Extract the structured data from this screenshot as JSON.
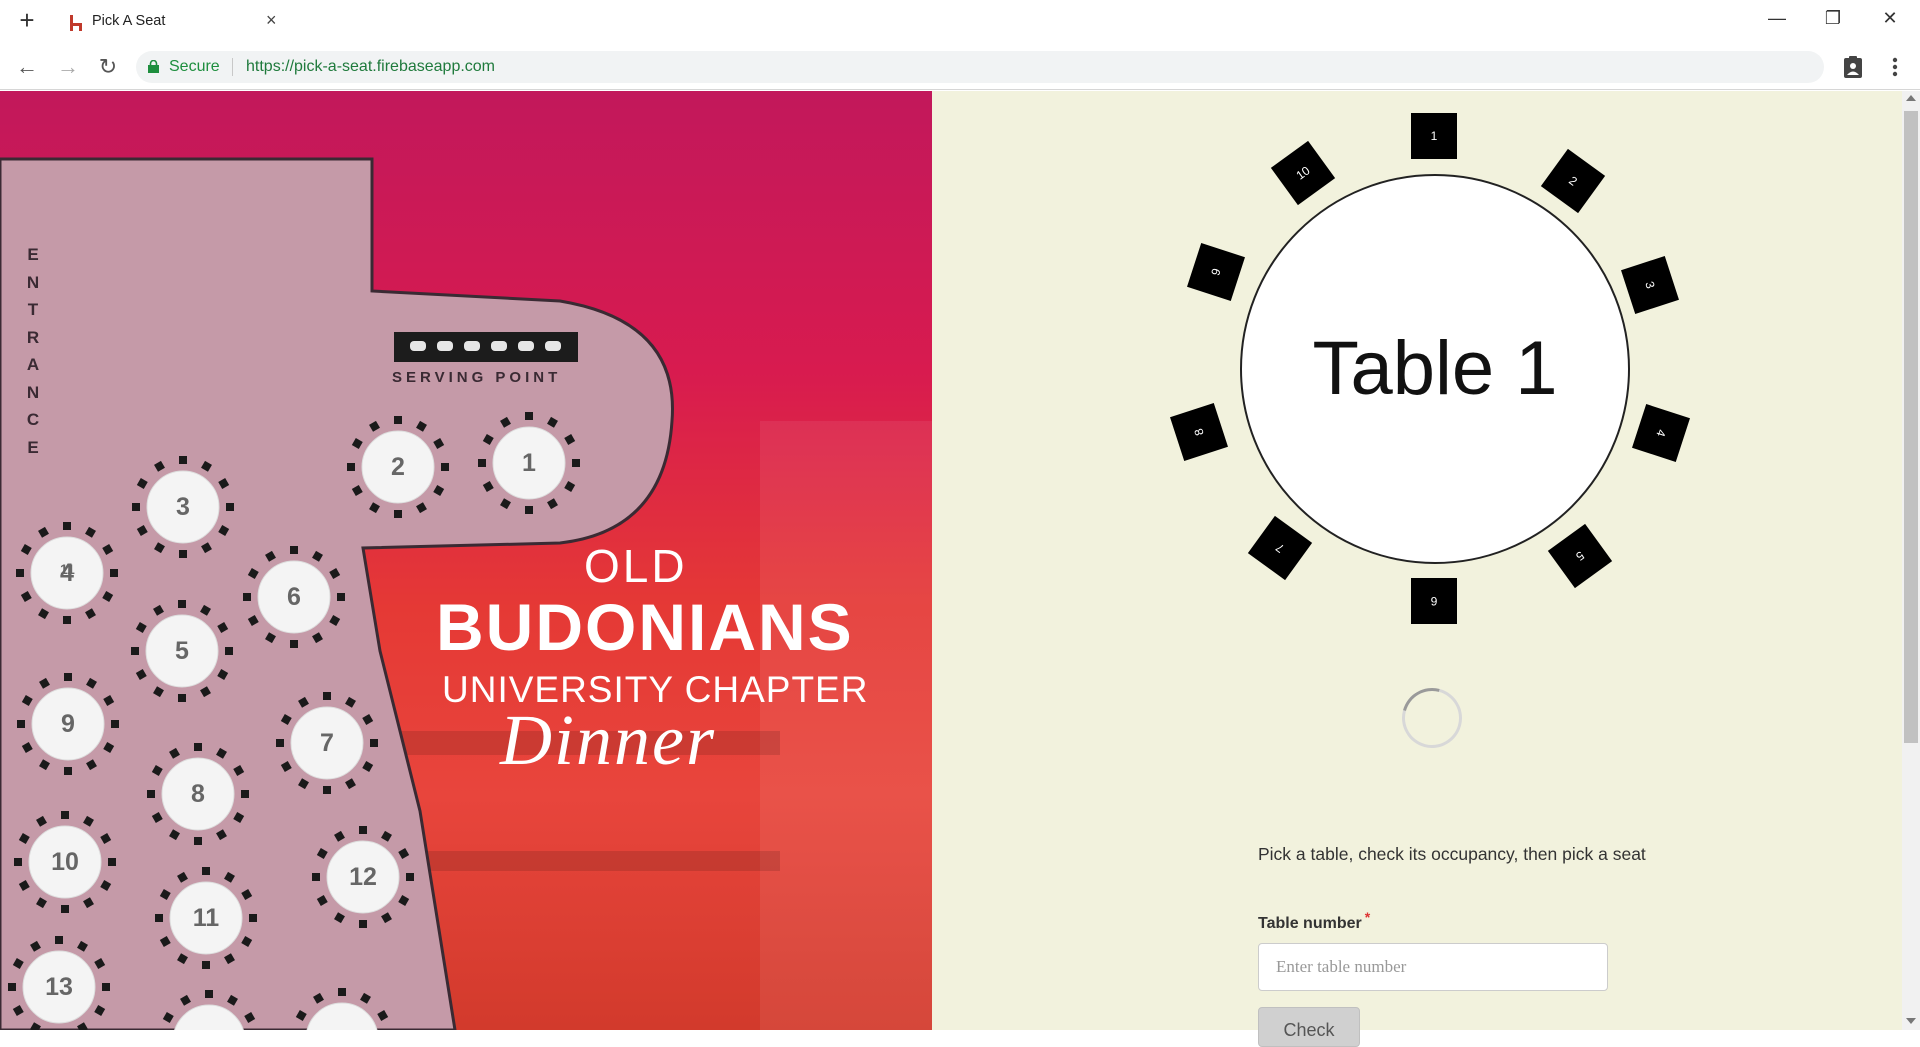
{
  "browser": {
    "new_tab": "+",
    "tab_title": "Pick A Seat",
    "tab_close": "×",
    "window_controls": {
      "minimize": "—",
      "restore": "❐",
      "close": "✕"
    },
    "nav": {
      "back": "←",
      "forward": "→",
      "reload": "↻"
    },
    "secure_label": "Secure",
    "url": "https://pick-a-seat.firebaseapp.com"
  },
  "poster": {
    "entrance_letters": [
      "E",
      "N",
      "T",
      "R",
      "A",
      "N",
      "C",
      "E"
    ],
    "serving_point": "SERVING POINT",
    "tables": [
      "1",
      "2",
      "3",
      "4",
      "5",
      "6",
      "7",
      "8",
      "9",
      "10",
      "11",
      "12",
      "13"
    ],
    "overlap_label": "11",
    "title_old": "OLD",
    "title_budonians": "BUDONIANS",
    "title_university": "UNIVERSITY CHAPTER",
    "title_dinner": "Dinner"
  },
  "seat_selector": {
    "table_label": "Table 1",
    "seats": [
      "1",
      "2",
      "3",
      "4",
      "5",
      "6",
      "7",
      "8",
      "9",
      "10"
    ],
    "instructions": "Pick a table, check its occupancy, then pick a seat",
    "field_label": "Table number",
    "required_mark": "*",
    "placeholder": "Enter table number",
    "check_button": "Check"
  },
  "colors": {
    "panel_bg": "#f2f2dd",
    "poster_red": "#e53935",
    "poster_magenta": "#c2185b",
    "secure_green": "#1e8e3e"
  }
}
